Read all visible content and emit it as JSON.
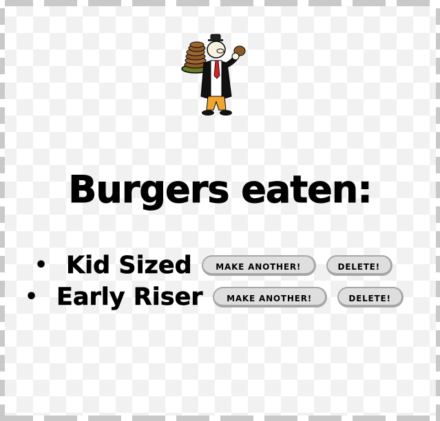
{
  "mascot": {
    "icon": "burger-mascot-illustration"
  },
  "title": "Burgers eaten:",
  "burgers": [
    {
      "name": "Kid Sized",
      "make_label": "MAKE ANOTHER!",
      "delete_label": "DELETE!"
    },
    {
      "name": "Early Riser",
      "make_label": "MAKE ANOTHER!",
      "delete_label": "DELETE!"
    }
  ],
  "colors": {
    "text": "#000000",
    "button_bg": "#dedede",
    "button_border": "#a6a6a6",
    "checker_light": "#ffffff",
    "checker_dark": "#f1f1f1",
    "border_pattern": "#c9c9c9"
  }
}
